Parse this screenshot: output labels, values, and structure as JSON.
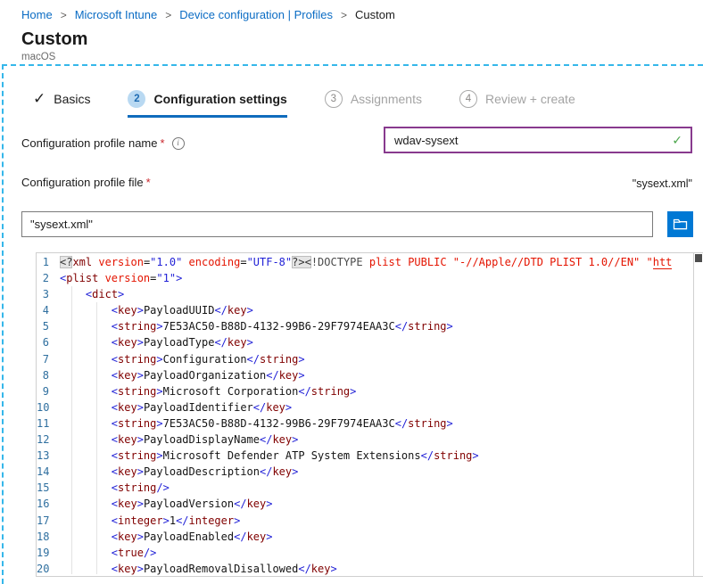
{
  "breadcrumb": {
    "separator": ">",
    "items": [
      {
        "label": "Home",
        "link": true
      },
      {
        "label": "Microsoft Intune",
        "link": true
      },
      {
        "label": "Device configuration | Profiles",
        "link": true
      },
      {
        "label": "Custom",
        "link": false
      }
    ]
  },
  "header": {
    "title": "Custom",
    "subtitle": "macOS"
  },
  "wizard": {
    "steps": [
      {
        "state": "done",
        "icon": "check-icon",
        "label": "Basics"
      },
      {
        "state": "active",
        "number": "2",
        "label": "Configuration settings"
      },
      {
        "state": "upcoming",
        "number": "3",
        "label": "Assignments"
      },
      {
        "state": "upcoming",
        "number": "4",
        "label": "Review + create"
      }
    ]
  },
  "form": {
    "name_field": {
      "label": "Configuration profile name",
      "required_mark": "*",
      "info_icon": "i",
      "value": "wdav-sysext",
      "valid_mark": "✓"
    },
    "file_field": {
      "label": "Configuration profile file",
      "required_mark": "*",
      "selected_file_display": "\"sysext.xml\"",
      "value": "\"sysext.xml\""
    }
  },
  "colors": {
    "accent_blue": "#0078d4",
    "link_blue": "#0b6cc4",
    "dashed_frame": "#35b7ea",
    "input_focus_purple": "#883a8e",
    "valid_green": "#4ca64c",
    "tag_maroon": "#800000",
    "attr_red": "#e41400",
    "delimiter_blue": "#1f1fd6",
    "line_number_blue": "#2f6f9f"
  },
  "editor": {
    "lines": [
      {
        "n": "1",
        "tokens": [
          [
            "hl",
            "<?"
          ],
          [
            "t",
            "xml"
          ],
          [
            "a",
            " version"
          ],
          [
            "p",
            "="
          ],
          [
            "v",
            "\"1.0\""
          ],
          [
            "a",
            " encoding"
          ],
          [
            "p",
            "="
          ],
          [
            "v",
            "\"UTF-8\""
          ],
          [
            "hl",
            "?><"
          ],
          [
            "g",
            "!DOCTYPE"
          ],
          [
            "r",
            " plist PUBLIC \"-//Apple//DTD PLIST 1.0//EN\" \""
          ],
          [
            "u",
            "htt"
          ]
        ]
      },
      {
        "n": "2",
        "tokens": [
          [
            "d",
            "<"
          ],
          [
            "t",
            "plist"
          ],
          [
            "a",
            " version"
          ],
          [
            "p",
            "="
          ],
          [
            "v",
            "\"1\""
          ],
          [
            "d",
            ">"
          ]
        ]
      },
      {
        "n": "3",
        "tokens": [
          [
            "w",
            "    "
          ],
          [
            "d",
            "<"
          ],
          [
            "t",
            "dict"
          ],
          [
            "d",
            ">"
          ]
        ]
      },
      {
        "n": "4",
        "tokens": [
          [
            "w",
            "        "
          ],
          [
            "d",
            "<"
          ],
          [
            "t",
            "key"
          ],
          [
            "d",
            ">"
          ],
          [
            "x",
            "PayloadUUID"
          ],
          [
            "d",
            "</"
          ],
          [
            "t",
            "key"
          ],
          [
            "d",
            ">"
          ]
        ]
      },
      {
        "n": "5",
        "tokens": [
          [
            "w",
            "        "
          ],
          [
            "d",
            "<"
          ],
          [
            "t",
            "string"
          ],
          [
            "d",
            ">"
          ],
          [
            "x",
            "7E53AC50-B88D-4132-99B6-29F7974EAA3C"
          ],
          [
            "d",
            "</"
          ],
          [
            "t",
            "string"
          ],
          [
            "d",
            ">"
          ]
        ]
      },
      {
        "n": "6",
        "tokens": [
          [
            "w",
            "        "
          ],
          [
            "d",
            "<"
          ],
          [
            "t",
            "key"
          ],
          [
            "d",
            ">"
          ],
          [
            "x",
            "PayloadType"
          ],
          [
            "d",
            "</"
          ],
          [
            "t",
            "key"
          ],
          [
            "d",
            ">"
          ]
        ]
      },
      {
        "n": "7",
        "tokens": [
          [
            "w",
            "        "
          ],
          [
            "d",
            "<"
          ],
          [
            "t",
            "string"
          ],
          [
            "d",
            ">"
          ],
          [
            "x",
            "Configuration"
          ],
          [
            "d",
            "</"
          ],
          [
            "t",
            "string"
          ],
          [
            "d",
            ">"
          ]
        ]
      },
      {
        "n": "8",
        "tokens": [
          [
            "w",
            "        "
          ],
          [
            "d",
            "<"
          ],
          [
            "t",
            "key"
          ],
          [
            "d",
            ">"
          ],
          [
            "x",
            "PayloadOrganization"
          ],
          [
            "d",
            "</"
          ],
          [
            "t",
            "key"
          ],
          [
            "d",
            ">"
          ]
        ]
      },
      {
        "n": "9",
        "tokens": [
          [
            "w",
            "        "
          ],
          [
            "d",
            "<"
          ],
          [
            "t",
            "string"
          ],
          [
            "d",
            ">"
          ],
          [
            "x",
            "Microsoft Corporation"
          ],
          [
            "d",
            "</"
          ],
          [
            "t",
            "string"
          ],
          [
            "d",
            ">"
          ]
        ]
      },
      {
        "n": "10",
        "tokens": [
          [
            "w",
            "        "
          ],
          [
            "d",
            "<"
          ],
          [
            "t",
            "key"
          ],
          [
            "d",
            ">"
          ],
          [
            "x",
            "PayloadIdentifier"
          ],
          [
            "d",
            "</"
          ],
          [
            "t",
            "key"
          ],
          [
            "d",
            ">"
          ]
        ]
      },
      {
        "n": "11",
        "tokens": [
          [
            "w",
            "        "
          ],
          [
            "d",
            "<"
          ],
          [
            "t",
            "string"
          ],
          [
            "d",
            ">"
          ],
          [
            "x",
            "7E53AC50-B88D-4132-99B6-29F7974EAA3C"
          ],
          [
            "d",
            "</"
          ],
          [
            "t",
            "string"
          ],
          [
            "d",
            ">"
          ]
        ]
      },
      {
        "n": "12",
        "tokens": [
          [
            "w",
            "        "
          ],
          [
            "d",
            "<"
          ],
          [
            "t",
            "key"
          ],
          [
            "d",
            ">"
          ],
          [
            "x",
            "PayloadDisplayName"
          ],
          [
            "d",
            "</"
          ],
          [
            "t",
            "key"
          ],
          [
            "d",
            ">"
          ]
        ]
      },
      {
        "n": "13",
        "tokens": [
          [
            "w",
            "        "
          ],
          [
            "d",
            "<"
          ],
          [
            "t",
            "string"
          ],
          [
            "d",
            ">"
          ],
          [
            "x",
            "Microsoft Defender ATP System Extensions"
          ],
          [
            "d",
            "</"
          ],
          [
            "t",
            "string"
          ],
          [
            "d",
            ">"
          ]
        ]
      },
      {
        "n": "14",
        "tokens": [
          [
            "w",
            "        "
          ],
          [
            "d",
            "<"
          ],
          [
            "t",
            "key"
          ],
          [
            "d",
            ">"
          ],
          [
            "x",
            "PayloadDescription"
          ],
          [
            "d",
            "</"
          ],
          [
            "t",
            "key"
          ],
          [
            "d",
            ">"
          ]
        ]
      },
      {
        "n": "15",
        "tokens": [
          [
            "w",
            "        "
          ],
          [
            "d",
            "<"
          ],
          [
            "t",
            "string"
          ],
          [
            "d",
            "/>"
          ]
        ]
      },
      {
        "n": "16",
        "tokens": [
          [
            "w",
            "        "
          ],
          [
            "d",
            "<"
          ],
          [
            "t",
            "key"
          ],
          [
            "d",
            ">"
          ],
          [
            "x",
            "PayloadVersion"
          ],
          [
            "d",
            "</"
          ],
          [
            "t",
            "key"
          ],
          [
            "d",
            ">"
          ]
        ]
      },
      {
        "n": "17",
        "tokens": [
          [
            "w",
            "        "
          ],
          [
            "d",
            "<"
          ],
          [
            "t",
            "integer"
          ],
          [
            "d",
            ">"
          ],
          [
            "x",
            "1"
          ],
          [
            "d",
            "</"
          ],
          [
            "t",
            "integer"
          ],
          [
            "d",
            ">"
          ]
        ]
      },
      {
        "n": "18",
        "tokens": [
          [
            "w",
            "        "
          ],
          [
            "d",
            "<"
          ],
          [
            "t",
            "key"
          ],
          [
            "d",
            ">"
          ],
          [
            "x",
            "PayloadEnabled"
          ],
          [
            "d",
            "</"
          ],
          [
            "t",
            "key"
          ],
          [
            "d",
            ">"
          ]
        ]
      },
      {
        "n": "19",
        "tokens": [
          [
            "w",
            "        "
          ],
          [
            "d",
            "<"
          ],
          [
            "t",
            "true"
          ],
          [
            "d",
            "/>"
          ]
        ]
      },
      {
        "n": "20",
        "tokens": [
          [
            "w",
            "        "
          ],
          [
            "d",
            "<"
          ],
          [
            "t",
            "key"
          ],
          [
            "d",
            ">"
          ],
          [
            "x",
            "PayloadRemovalDisallowed"
          ],
          [
            "d",
            "</"
          ],
          [
            "t",
            "key"
          ],
          [
            "d",
            ">"
          ]
        ]
      }
    ]
  }
}
